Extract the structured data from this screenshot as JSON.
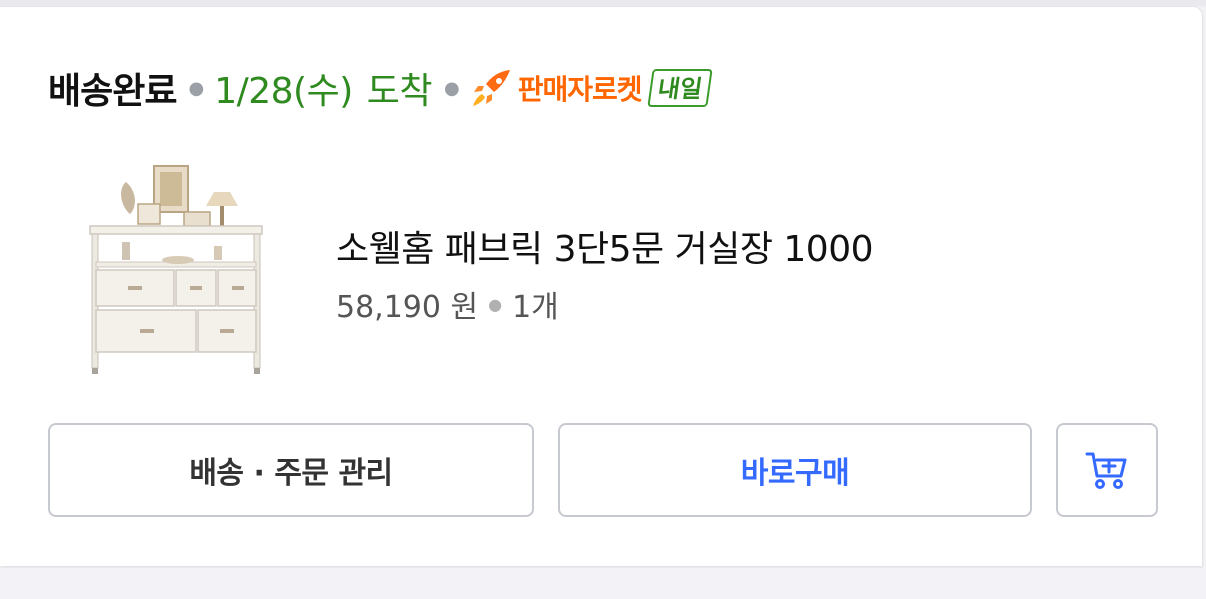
{
  "order": {
    "status": "배송완료",
    "arrival_date": "1/28(수)",
    "arrival_label": "도착",
    "delivery_type": "판매자로켓",
    "delivery_badge": "내일",
    "accent_green": "#2f8a1f",
    "accent_orange": "#ff6600"
  },
  "product": {
    "name": "소웰홈 패브릭 3단5문 거실장 1000",
    "price": "58,190 원",
    "quantity": "1개",
    "image_icon": "fabric-drawer-cabinet-image"
  },
  "actions": {
    "manage_label": "배송 · 주문 관리",
    "buy_label": "바로구매",
    "cart_icon": "add-to-cart-icon",
    "buy_color": "#346aff"
  }
}
